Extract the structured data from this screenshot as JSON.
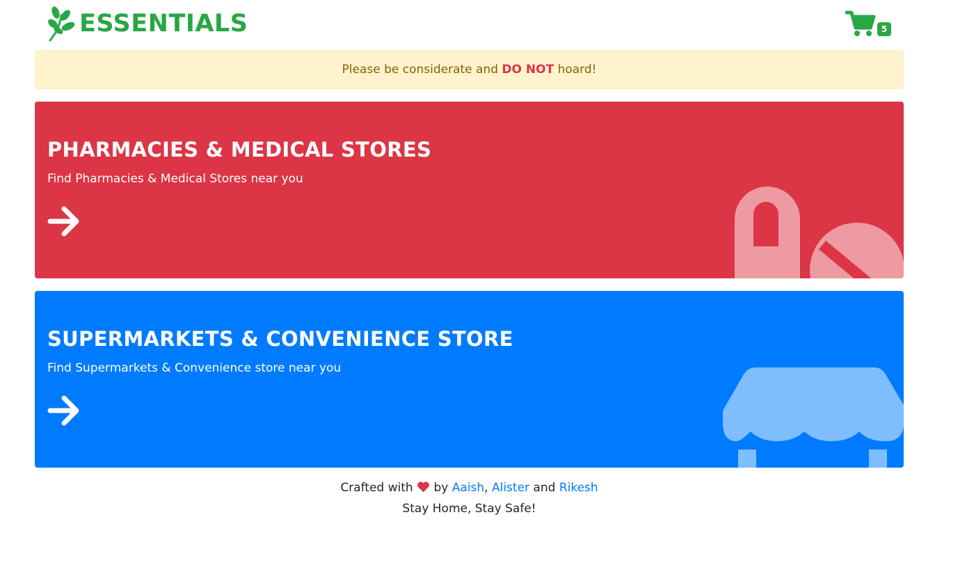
{
  "brand": {
    "name": "ESSENTIALS",
    "logo_icon": "leaf-icon",
    "color": "#28a745"
  },
  "cart": {
    "icon": "shopping-cart-icon",
    "count": "5"
  },
  "alert": {
    "text_before": "Please be considerate and ",
    "emphasis": "DO NOT",
    "text_after": " hoard!"
  },
  "cards": [
    {
      "title": "PHARMACIES & MEDICAL STORES",
      "subtitle": "Find Pharmacies & Medical Stores near you",
      "color": "#dc3545",
      "icon": "pills-icon"
    },
    {
      "title": "SUPERMARKETS & CONVENIENCE STORE",
      "subtitle": "Find Supermarkets & Convenience store near you",
      "color": "#007bff",
      "icon": "store-awning-icon"
    }
  ],
  "footer": {
    "crafted": "Crafted with",
    "by": "by",
    "author1": "Aaish",
    "sep": ",",
    "author2": "Alister",
    "and": "and",
    "author3": "Rikesh",
    "tagline": "Stay Home, Stay Safe!"
  }
}
